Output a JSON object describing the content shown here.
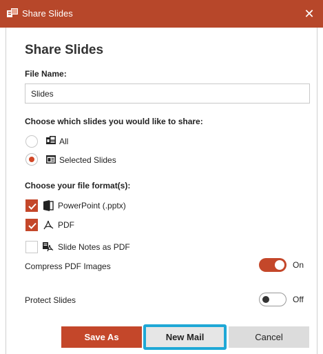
{
  "window": {
    "title": "Share Slides",
    "close_glyph": "✕",
    "accent_color": "#b7472a"
  },
  "heading": "Share Slides",
  "file_name": {
    "label": "File Name:",
    "value": "Slides"
  },
  "slides_choice": {
    "label": "Choose which slides you would like to share:",
    "options": [
      {
        "label": "All",
        "checked": false,
        "icon": "slides-all-icon"
      },
      {
        "label": "Selected Slides",
        "checked": true,
        "icon": "selected-slides-icon"
      }
    ]
  },
  "formats": {
    "label": "Choose your file format(s):",
    "options": [
      {
        "label": "PowerPoint (.pptx)",
        "checked": true,
        "icon": "powerpoint-icon"
      },
      {
        "label": "PDF",
        "checked": true,
        "icon": "pdf-icon"
      },
      {
        "label": "Slide Notes as PDF",
        "checked": false,
        "icon": "slide-notes-pdf-icon"
      }
    ]
  },
  "compress": {
    "label": "Compress PDF Images",
    "state_text": "On",
    "on": true
  },
  "protect": {
    "label": "Protect Slides",
    "state_text": "Off",
    "on": false
  },
  "buttons": {
    "save_as": "Save As",
    "new_mail": "New Mail",
    "cancel": "Cancel"
  }
}
